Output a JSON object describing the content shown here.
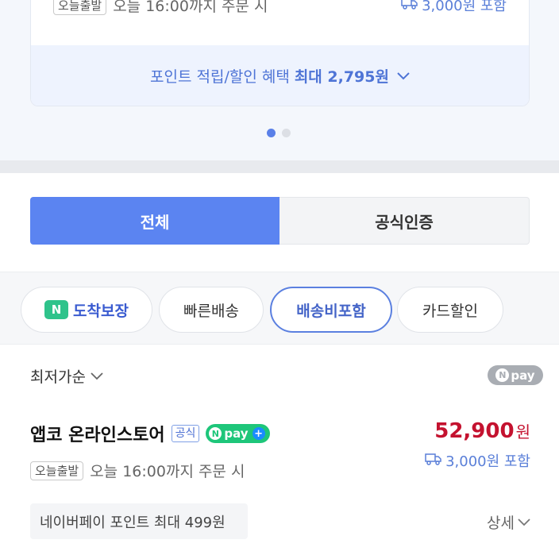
{
  "top_card": {
    "dispatch_tag": "오늘출발",
    "dispatch_text": "오늘 16:00까지 주문 시",
    "shipping_text": "3,000원 포함",
    "point_text": "포인트 적립/할인 혜택",
    "point_max_label": "최대 2,795원"
  },
  "carousel": {
    "total": 2,
    "active": 1
  },
  "tabs": [
    {
      "label": "전체",
      "selected": true
    },
    {
      "label": "공식인증",
      "selected": false
    }
  ],
  "filters": {
    "arrival_guarantee": {
      "badge": "N",
      "label": "도착보장"
    },
    "fast_delivery": "빠른배송",
    "shipping_included": "배송비포함",
    "card_discount": "카드할인"
  },
  "sort": {
    "label": "최저가순"
  },
  "npay_filter": {
    "label": "pay"
  },
  "listing": {
    "store_name": "앱코 온라인스토어",
    "official_badge": "공식",
    "npay_plus_label": "pay",
    "price": "52,900",
    "price_unit": "원",
    "shipping": "3,000원 포함",
    "dispatch_tag": "오늘출발",
    "dispatch_text": "오늘 16:00까지 주문 시",
    "points": "네이버페이 포인트 최대 499원",
    "detail_label": "상세"
  },
  "colors": {
    "accent": "#5b84f1",
    "price": "#c4122f",
    "link_blue": "#5a7fd8",
    "npay_green": "#1ec67a"
  }
}
